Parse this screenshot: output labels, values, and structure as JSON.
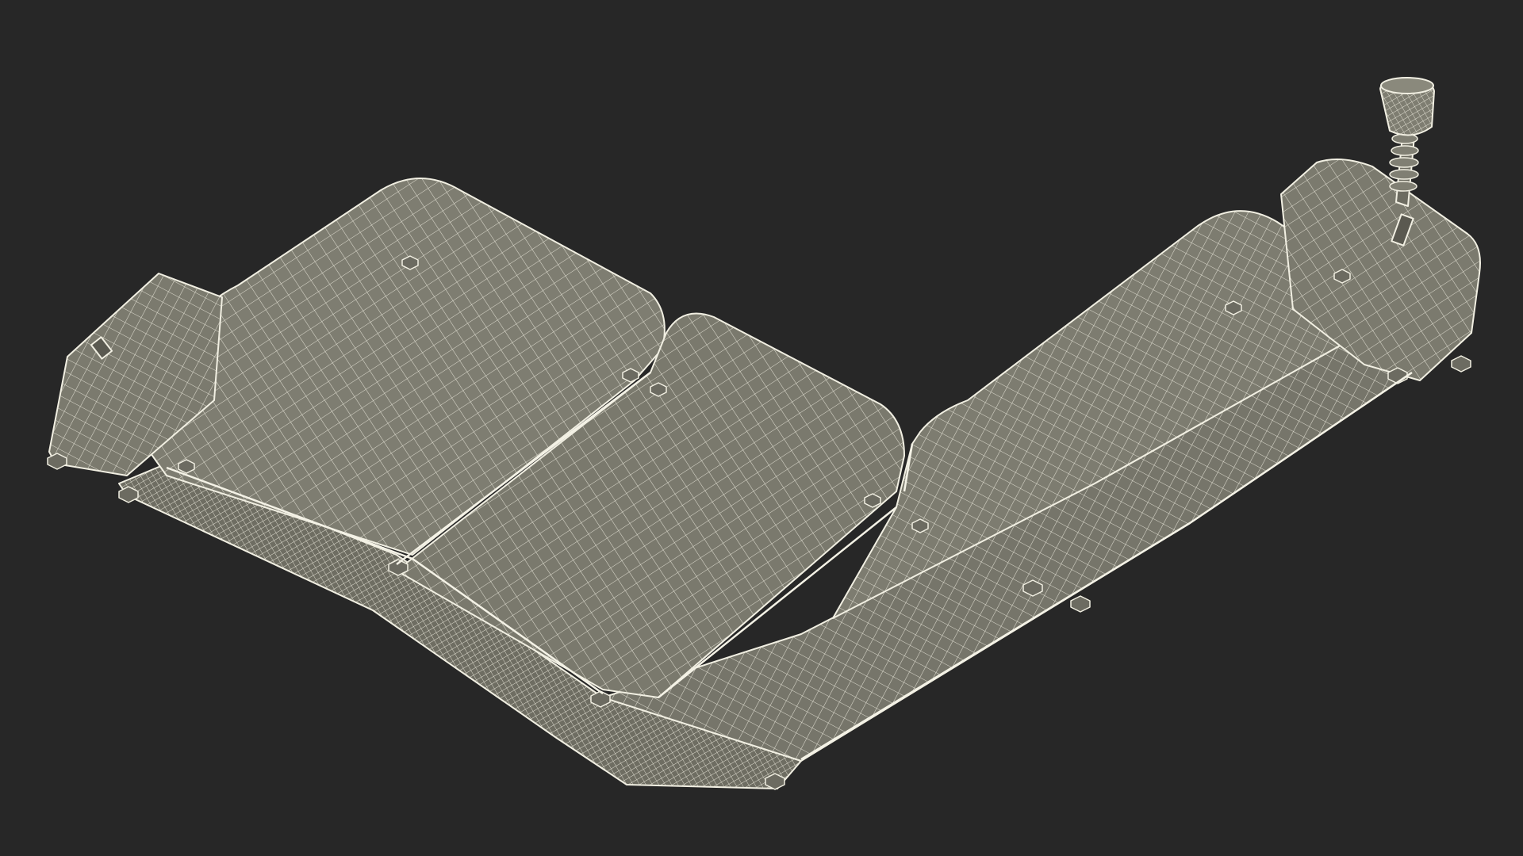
{
  "scene": {
    "subject": "wireframe-sectional-sofa",
    "background_color": "#272727",
    "mesh_fill_color": "#7c7b6f",
    "mesh_fill_dark_color": "#5f5e54",
    "wire_color": "#f1efe2",
    "foot_color": "#6c6b61"
  }
}
